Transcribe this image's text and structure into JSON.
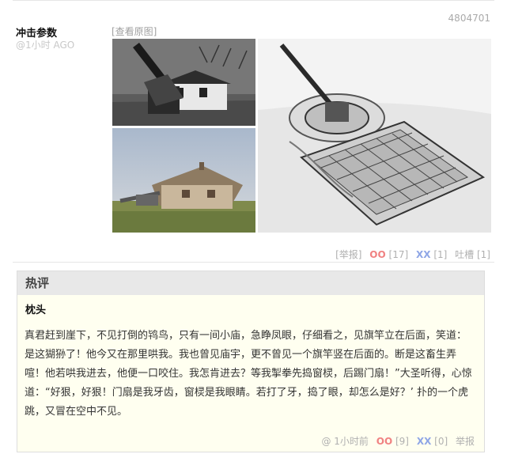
{
  "post": {
    "id": "4804701",
    "author": "冲击参数",
    "time": "@1小时 AGO",
    "view_original": "[查看原图]"
  },
  "actions": {
    "report": "[举报]",
    "oo_label": "OO",
    "oo_count": "[17]",
    "xx_label": "XX",
    "xx_count": "[1]",
    "comment": "吐槽 [1]"
  },
  "hot": {
    "header": "热评",
    "author": "枕头",
    "text": "真君赶到崖下，不见打倒的鸨鸟，只有一间小庙，急睁凤眼，仔细看之，见旗竿立在后面，笑道：是这猢狲了！他今又在那里哄我。我也曾见庙宇，更不曾见一个旗竿竖在后面的。断是这畜生弄喧！他若哄我进去，他便一口咬住。我怎肯进去？等我掣拳先捣窗棂，后踢门扇！”大圣听得，心惊道：“好狠，好狠！门扇是我牙齿，窗棂是我眼睛。若打了牙，捣了眼，却怎么是好？’ 扑的一个虎跳，又冒在空中不见。",
    "footer_at": "@",
    "footer_time": "1小时前",
    "oo_label": "OO",
    "oo_count": "[9]",
    "xx_label": "XX",
    "xx_count": "[0]",
    "report": "举报"
  }
}
